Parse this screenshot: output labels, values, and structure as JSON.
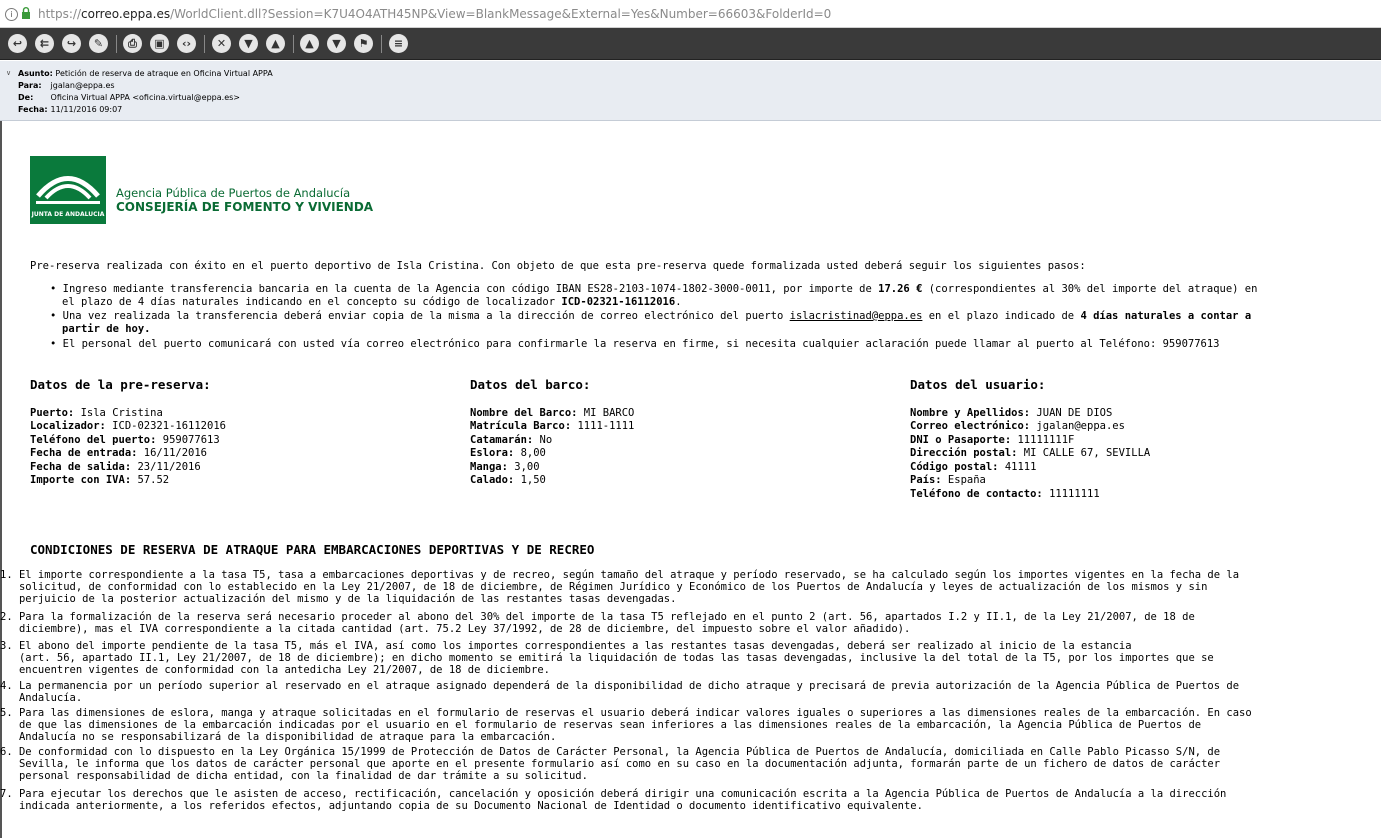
{
  "browser": {
    "url_scheme": "https://",
    "url_host": "correo.eppa.es",
    "url_rest": "/WorldClient.dll?Session=K7U4O4ATH45NP&View=BlankMessage&External=Yes&Number=66603&FolderId=0"
  },
  "toolbar": {
    "buttons": [
      "reply-icon",
      "reply-all-icon",
      "forward-icon",
      "edit-icon",
      "print-icon",
      "save-icon",
      "source-icon",
      "delete-icon",
      "junk-icon",
      "not-junk-icon",
      "previous-icon",
      "next-icon",
      "flag-icon",
      "menu-icon"
    ]
  },
  "header": {
    "subject_label": "Asunto:",
    "subject": "Petición de reserva de atraque en Oficina Virtual APPA",
    "to_label": "Para:",
    "to": "jgalan@eppa.es",
    "from_label": "De:",
    "from": "Oficina Virtual APPA <oficina.virtual@eppa.es>",
    "date_label": "Fecha:",
    "date": "11/11/2016 09:07"
  },
  "logo": {
    "seal_text": "JUNTA DE ANDALUCIA",
    "org_line1": "Agencia Pública de Puertos de Andalucía",
    "org_line2": "CONSEJERÍA DE FOMENTO Y VIVIENDA"
  },
  "intro": "Pre-reserva realizada con éxito en el puerto deportivo de Isla Cristina. Con objeto de que esta pre-reserva quede formalizada usted deberá seguir los siguientes pasos:",
  "steps": {
    "s1_a": "Ingreso mediante transferencia bancaria en la cuenta de la Agencia con código IBAN ES28-2103-1074-1802-3000-0011, por importe de ",
    "s1_amount": "17.26 €",
    "s1_b": " (correspondientes al 30% del importe del atraque) en",
    "s1_c": "el plazo de 4 días naturales indicando en el concepto su código de localizador ",
    "s1_code": "ICD-02321-16112016",
    "s1_d": ".",
    "s2_a": "Una vez realizada la transferencia deberá enviar copia de la misma a la dirección de correo electrónico del puerto ",
    "s2_email": "islacristinad@eppa.es",
    "s2_b": " en el plazo indicado de ",
    "s2_bold1": "4 días naturales a contar a",
    "s2_bold2": "partir de hoy.",
    "s3": "El personal del puerto comunicará con usted vía correo electrónico para confirmarle la reserva en firme, si necesita cualquier aclaración puede llamar al puerto al Teléfono: 959077613"
  },
  "reserva": {
    "title": "Datos de la pre-reserva:",
    "fields": [
      {
        "label": "Puerto:",
        "value": " Isla Cristina"
      },
      {
        "label": "Localizador:",
        "value": " ICD-02321-16112016"
      },
      {
        "label": "Teléfono del puerto:",
        "value": " 959077613"
      },
      {
        "label": "Fecha de entrada:",
        "value": " 16/11/2016"
      },
      {
        "label": "Fecha de salida:",
        "value": " 23/11/2016"
      },
      {
        "label": "Importe con IVA:",
        "value": " 57.52"
      }
    ]
  },
  "barco": {
    "title": "Datos del barco:",
    "fields": [
      {
        "label": "Nombre del Barco:",
        "value": " MI BARCO"
      },
      {
        "label": "Matrícula Barco:",
        "value": " 1111-1111"
      },
      {
        "label": "Catamarán:",
        "value": " No"
      },
      {
        "label": "Eslora:",
        "value": " 8,00"
      },
      {
        "label": "Manga:",
        "value": " 3,00"
      },
      {
        "label": "Calado:",
        "value": " 1,50"
      }
    ]
  },
  "usuario": {
    "title": "Datos del usuario:",
    "fields": [
      {
        "label": "Nombre y Apellidos:",
        "value": " JUAN DE DIOS"
      },
      {
        "label": "Correo electrónico:",
        "value": " jgalan@eppa.es"
      },
      {
        "label": "DNI o Pasaporte:",
        "value": " 11111111F"
      },
      {
        "label": "Dirección postal:",
        "value": " MI CALLE 67, SEVILLA"
      },
      {
        "label": "Código postal:",
        "value": " 41111"
      },
      {
        "label": "País:",
        "value": " España"
      },
      {
        "label": "Teléfono de contacto:",
        "value": " 11111111"
      }
    ]
  },
  "conditions": {
    "title": "CONDICIONES DE RESERVA DE ATRAQUE PARA EMBARCACIONES DEPORTIVAS Y DE RECREO",
    "lines": [
      "1. El importe correspondiente a la tasa T5, tasa a embarcaciones deportivas y de recreo, según tamaño del atraque y período reservado, se ha calculado según los importes vigentes en la fecha de la",
      "   solicitud, de conformidad con lo establecido en la Ley 21/2007, de 18 de diciembre, de Régimen Jurídico y Económico de los Puertos de Andalucía y leyes de actualización de los mismos y sin",
      "   perjuicio de la posterior actualización del mismo y de la liquidación de las restantes tasas devengadas.",
      "2. Para la formalización de la reserva será necesario proceder al abono del 30% del importe de la tasa T5 reflejado en el punto 2 (art. 56, apartados I.2 y II.1, de la Ley 21/2007, de 18 de",
      "   diciembre), mas el IVA correspondiente a la citada cantidad (art. 75.2 Ley 37/1992, de 28 de diciembre, del impuesto sobre el valor añadido).",
      "3. El abono del importe pendiente de la tasa T5, más el IVA, así como los importes correspondientes a las restantes tasas devengadas, deberá ser realizado al inicio de la estancia",
      "   (art. 56, apartado II.1, Ley 21/2007, de 18 de diciembre); en dicho momento se emitirá la liquidación de todas las tasas devengadas, inclusive la del total de la T5, por los importes que se",
      "   encuentren vigentes de conformidad con la antedicha Ley 21/2007, de 18 de diciembre.",
      "4. La permanencia por un período superior al reservado en el atraque asignado dependerá de la disponibilidad de dicho atraque y precisará de previa autorización de la Agencia Pública de Puertos de",
      "   Andalucía.",
      "5. Para las dimensiones de eslora, manga y atraque solicitadas en el formulario de reservas el usuario deberá indicar valores iguales o superiores a las dimensiones reales de la embarcación. En caso",
      "   de que las dimensiones de la embarcación indicadas por el usuario en el formulario de reservas sean inferiores a las dimensiones reales de la embarcación, la Agencia Pública de Puertos de",
      "   Andalucía no se responsabilizará de la disponibilidad de atraque para la embarcación.",
      "6. De conformidad con lo dispuesto en la Ley Orgánica 15/1999 de Protección de Datos de Carácter Personal, la Agencia Pública de Puertos de Andalucía, domiciliada en Calle Pablo Picasso S/N, de",
      "   Sevilla, le informa que los datos de carácter personal que aporte en el presente formulario así como en su caso en la documentación adjunta, formarán parte de un fichero de datos de carácter",
      "   personal responsabilidad de dicha entidad, con la finalidad de dar trámite a su solicitud.",
      "7. Para ejecutar los derechos que le asisten de acceso, rectificación, cancelación y oposición deberá dirigir una comunicación escrita a la Agencia Pública de Puertos de Andalucía a la dirección",
      "   indicada anteriormente, a los referidos efectos, adjuntando copia de su Documento Nacional de Identidad o documento identificativo equivalente."
    ]
  },
  "colors": {
    "brand_green": "#0a7a3c",
    "toolbar_bg": "#3a3a3a",
    "header_bg": "#e8ecf2"
  }
}
